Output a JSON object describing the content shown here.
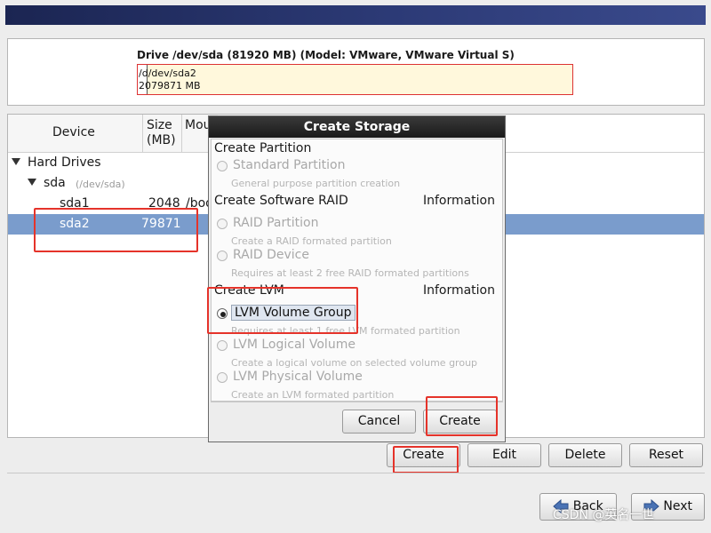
{
  "drive": {
    "title": "Drive /dev/sda (81920 MB) (Model: VMware, VMware Virtual S)",
    "bar_line1": "/d/dev/sda2",
    "bar_line2": "2079871 MB"
  },
  "table": {
    "col_device": "Device",
    "col_size": "Size\n(MB)",
    "col_mount": "Mou",
    "rows": [
      {
        "device": "Hard Drives",
        "size": "",
        "mount": ""
      },
      {
        "device": "sda",
        "detail": "(/dev/sda)",
        "size": "",
        "mount": ""
      },
      {
        "device": "sda1",
        "size": "2048",
        "mount": "/boo"
      },
      {
        "device": "sda2",
        "size": "79871",
        "mount": ""
      }
    ]
  },
  "dialog": {
    "title": "Create Storage",
    "sections": {
      "partition": "Create Partition",
      "raid": "Create Software RAID",
      "lvm": "Create LVM"
    },
    "info_label_raid": "Information",
    "info_label_lvm": "Information",
    "options": {
      "standard_partition": {
        "label": "Standard Partition",
        "desc": "General purpose partition creation"
      },
      "raid_partition": {
        "label": "RAID Partition",
        "desc": "Create a RAID formated partition"
      },
      "raid_device": {
        "label": "RAID Device",
        "desc": "Requires at least 2 free RAID formated partitions"
      },
      "lvm_volume_group": {
        "label": "LVM Volume Group",
        "desc": "Requires at least 1 free LVM formated partition"
      },
      "lvm_logical_volume": {
        "label": "LVM Logical Volume",
        "desc": "Create a logical volume on selected volume group"
      },
      "lvm_physical_volume": {
        "label": "LVM Physical Volume",
        "desc": "Create an LVM formated partition"
      }
    },
    "selected_option": "LVM Volume Group",
    "cancel_label": "Cancel",
    "create_label": "Create"
  },
  "toolbar": {
    "create_label": "Create",
    "edit_label": "Edit",
    "delete_label": "Delete",
    "reset_label": "Reset"
  },
  "nav": {
    "back_label": "Back",
    "next_label": "Next"
  },
  "watermark": "CSDN @英名一世",
  "colors": {
    "selection": "#7a9ccc",
    "highlight_box": "#e5332a",
    "banner": "#2c3a76"
  }
}
